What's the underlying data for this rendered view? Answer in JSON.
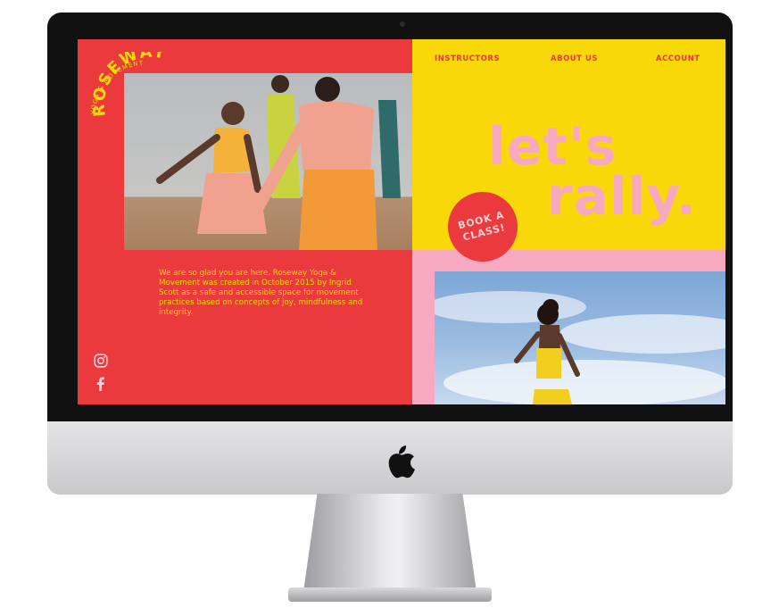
{
  "site": {
    "brand": "ROSEWAY",
    "brand_tagline": "YOGA & MOVEMENT",
    "nav": [
      {
        "label": "INSTRUCTORS"
      },
      {
        "label": "ABOUT US"
      },
      {
        "label": "ACCOUNT"
      }
    ],
    "headline_line1": "let's",
    "headline_line2": "rally.",
    "book_button_line1": "BOOK A",
    "book_button_line2": "CLASS!",
    "intro": "We are so glad you are here. Roseway Yoga & Movement was created in October 2015 by Ingrid Scott as a safe and accessible space for movement practices based on concepts of joy, mindfulness and integrity.",
    "social_icons": [
      "instagram-icon",
      "facebook-icon"
    ]
  },
  "colors": {
    "red": "#eb3a3d",
    "yellow": "#f9d80a",
    "pink": "#f6a9c1"
  },
  "device": {
    "logo_icon": "apple-icon"
  }
}
